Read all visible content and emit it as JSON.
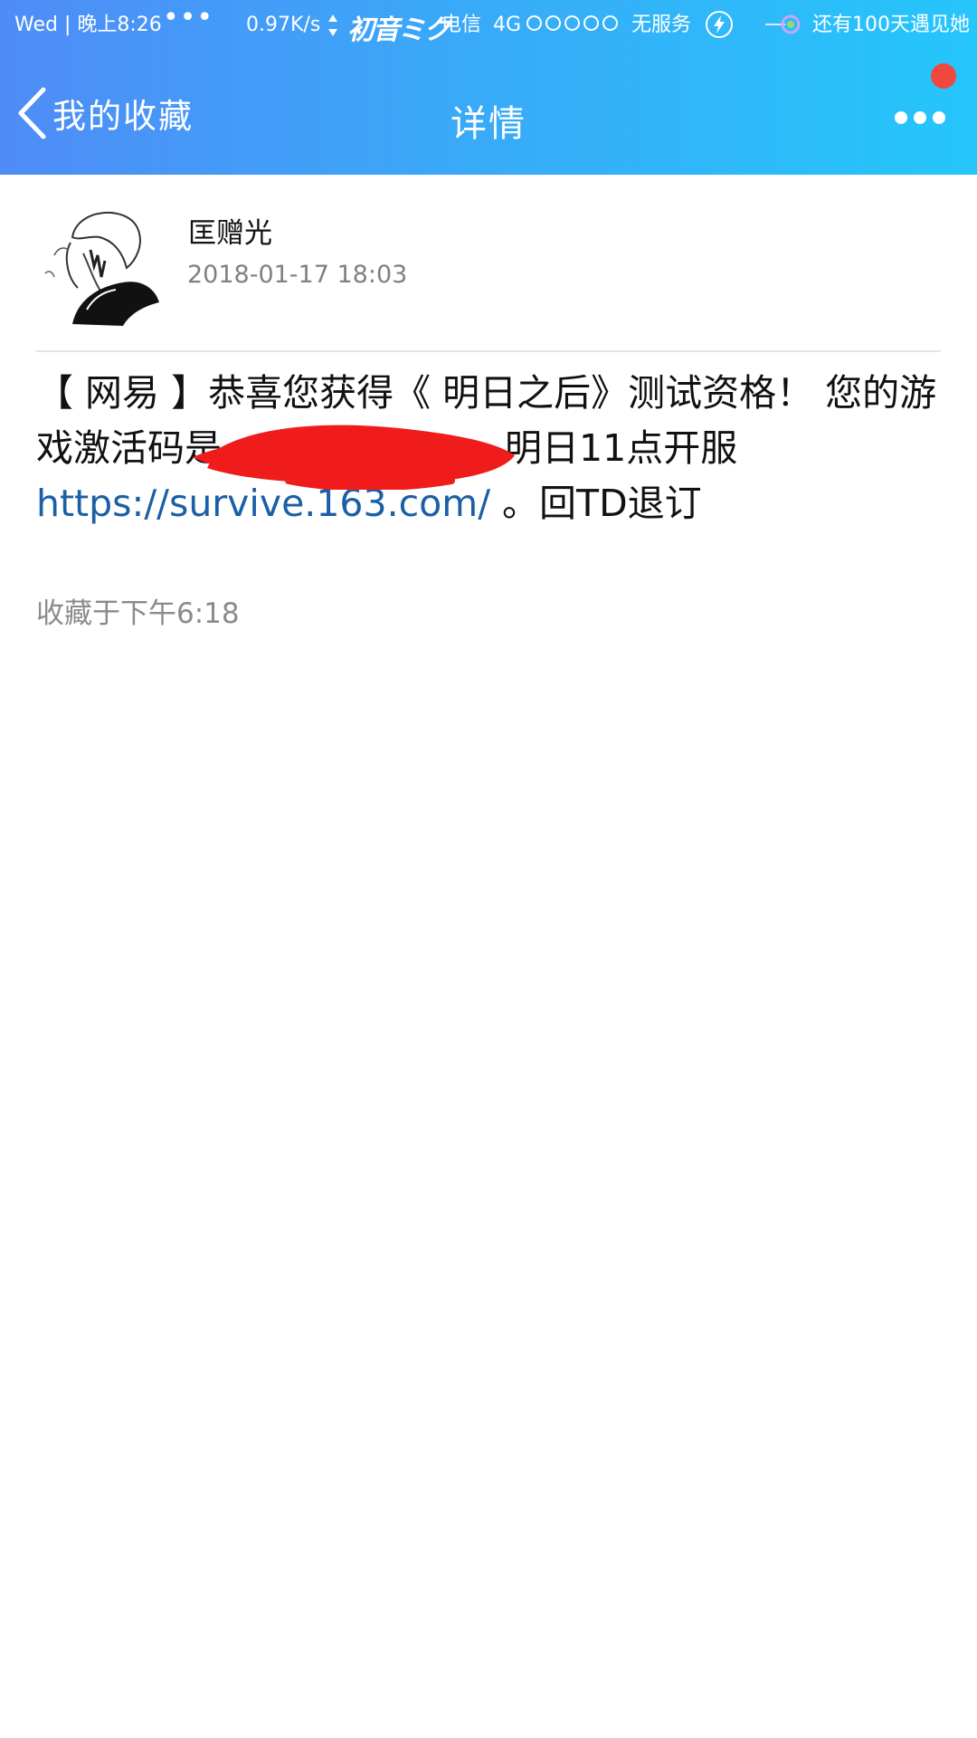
{
  "status_bar": {
    "day": "Wed",
    "time": "晚上8:26",
    "dots": "•••",
    "speed": "0.97K/s",
    "logo_text": "初音ミク",
    "carrier": "电信",
    "network": "4G",
    "signal_circles": 5,
    "service": "无服务",
    "countdown": "还有100天遇见她"
  },
  "nav": {
    "back_label": "我的收藏",
    "title": "详情",
    "has_notification_dot": true
  },
  "sender": {
    "name": "匡赠光",
    "datetime": "2018-01-17 18:03"
  },
  "message": {
    "part1": "【 网易 】恭喜您获得《 明日之后》测试资格！ 您的游戏激活码是",
    "part2": " 明日11点开服",
    "link_text": "https://survive.163.com/",
    "part3": " 。回TD退订"
  },
  "favorite": {
    "saved_at": "收藏于下午6:18"
  },
  "colors": {
    "header_gradient_start": "#4f8cf7",
    "header_gradient_end": "#25c6fb",
    "link": "#1b5fa4",
    "notification_dot": "#f0483e",
    "redaction": "#f01c1c"
  }
}
